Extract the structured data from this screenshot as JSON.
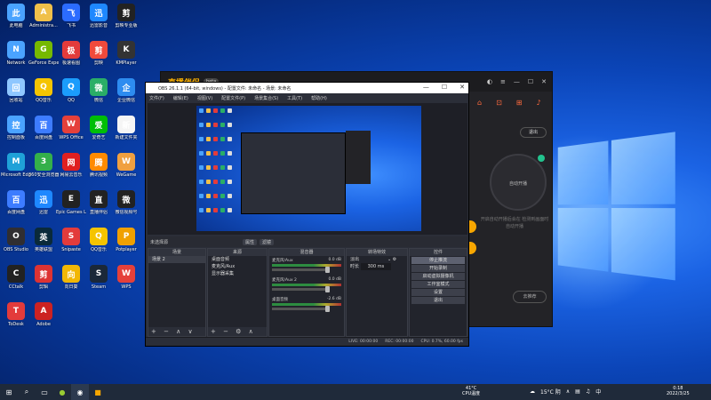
{
  "desktop": {
    "icons": [
      {
        "label": "此电脑",
        "icon": "computer-icon",
        "color": "#4aa3ff"
      },
      {
        "label": "Administra...",
        "icon": "user-folder-icon",
        "color": "#f0c04a"
      },
      {
        "label": "飞书",
        "icon": "feishu-icon",
        "color": "#2b6cff"
      },
      {
        "label": "迅雷影音",
        "icon": "xunlei-icon",
        "color": "#1e88ff"
      },
      {
        "label": "剪映专业版",
        "icon": "jianying-icon",
        "color": "#222222"
      },
      {
        "label": "Network",
        "icon": "network-icon",
        "color": "#4aa3ff"
      },
      {
        "label": "GeForce Experience",
        "icon": "nvidia-icon",
        "color": "#76b900"
      },
      {
        "label": "极速看图",
        "icon": "image-viewer-icon",
        "color": "#e33b3b"
      },
      {
        "label": "剪映",
        "icon": "jianying-app-icon",
        "color": "#f04a3c"
      },
      {
        "label": "KMPlayer",
        "icon": "kmplayer-icon",
        "color": "#333333"
      },
      {
        "label": "回收站",
        "icon": "recycle-bin-icon",
        "color": "#8fc7ff"
      },
      {
        "label": "QQ音乐",
        "icon": "qqmusic-icon",
        "color": "#f5c400"
      },
      {
        "label": "QQ",
        "icon": "qq-icon",
        "color": "#1b9cfc"
      },
      {
        "label": "微信",
        "icon": "wechat-icon",
        "color": "#2aae67"
      },
      {
        "label": "企业微信",
        "icon": "wework-icon",
        "color": "#2d8cf0"
      },
      {
        "label": "控制面板",
        "icon": "control-panel-icon",
        "color": "#4aa3ff"
      },
      {
        "label": "百度网盘",
        "icon": "baidu-pan-icon",
        "color": "#3d7cff"
      },
      {
        "label": "WPS Office",
        "icon": "wps-icon",
        "color": "#e5403a"
      },
      {
        "label": "爱奇艺",
        "icon": "iqiyi-icon",
        "color": "#00be06"
      },
      {
        "label": "新建文件夹",
        "icon": "new-file-icon",
        "color": "#f5f5f5"
      },
      {
        "label": "Microsoft Edge",
        "icon": "edge-icon",
        "color": "#1fa1d8"
      },
      {
        "label": "360安全浏览器",
        "icon": "browser-360-icon",
        "color": "#34b04a"
      },
      {
        "label": "网易云音乐",
        "icon": "netease-music-icon",
        "color": "#e02020"
      },
      {
        "label": "腾讯视频",
        "icon": "tencent-video-icon",
        "color": "#ff8b00"
      },
      {
        "label": "WeGame",
        "icon": "wegame-icon",
        "color": "#f0a040"
      },
      {
        "label": "百度网盘",
        "icon": "pan-icon",
        "color": "#3d7cff"
      },
      {
        "label": "迅雷",
        "icon": "thunder-icon",
        "color": "#1e88ff"
      },
      {
        "label": "Epic Games Launcher",
        "icon": "epic-icon",
        "color": "#222222"
      },
      {
        "label": "直播伴侣",
        "icon": "zbbl-icon",
        "color": "#222222"
      },
      {
        "label": "微信视频号",
        "icon": "channels-icon",
        "color": "#222222"
      },
      {
        "label": "OBS Studio",
        "icon": "obs-icon",
        "color": "#302e31"
      },
      {
        "label": "英雄联盟",
        "icon": "lol-icon",
        "color": "#0a2a3a"
      },
      {
        "label": "Snipaste",
        "icon": "snipaste-icon",
        "color": "#e33b3b"
      },
      {
        "label": "QQ音乐",
        "icon": "qqmusic2-icon",
        "color": "#f5c400"
      },
      {
        "label": "Potplayer",
        "icon": "potplayer-icon",
        "color": "#f0a000"
      },
      {
        "label": "CCtalk",
        "icon": "cctalk-icon",
        "color": "#222222"
      },
      {
        "label": "剪辑",
        "icon": "editor-icon",
        "color": "#d33"
      },
      {
        "label": "向日葵",
        "icon": "sunlogin-icon",
        "color": "#f2b705"
      },
      {
        "label": "Steam",
        "icon": "steam-icon",
        "color": "#1b2838"
      },
      {
        "label": "WPS",
        "icon": "wps2-icon",
        "color": "#e5403a"
      },
      {
        "label": "ToDesk",
        "icon": "todesk-icon",
        "color": "#e33b3b"
      },
      {
        "label": "Adobe",
        "icon": "adobe-icon",
        "color": "#cc2222"
      }
    ]
  },
  "zbapp": {
    "title": "直播伴侣",
    "version": "beta",
    "exit_label": "退出",
    "auto_label": "自动开播",
    "hint": "开启自动开播后会在\n检测到画面时自动开播",
    "preview_btn": "去推荐"
  },
  "obs": {
    "title": "OBS 26.1.1 (64-bit, windows) - 配置文件: 未命名 - 场景: 未命名",
    "menu": [
      "文件(F)",
      "编辑(E)",
      "视图(V)",
      "配置文件(P)",
      "场景集合(S)",
      "工具(T)",
      "帮助(H)"
    ],
    "source_bar": {
      "label": "未选择源",
      "props": "属性",
      "filters": "滤镜"
    },
    "docks": {
      "scenes": {
        "title": "场景",
        "items": [
          "场景 2"
        ]
      },
      "sources": {
        "title": "来源",
        "items": [
          "桌面音频",
          "麦克风/Aux",
          "显示器采集"
        ]
      },
      "mixer": {
        "title": "混音器",
        "channels": [
          {
            "name": "麦克风/Aux",
            "level": "0.0 dB"
          },
          {
            "name": "麦克风/Aux 2",
            "level": "0.0 dB"
          },
          {
            "name": "桌面音频",
            "level": "-2.6 dB"
          }
        ]
      },
      "transitions": {
        "title": "转场特效",
        "type": "淡出",
        "duration_label": "时长",
        "duration": "300 ms"
      },
      "controls": {
        "title": "控件",
        "buttons": [
          "停止推流",
          "开始录制",
          "启动虚拟摄像机",
          "工作室模式",
          "设置",
          "退出"
        ]
      }
    },
    "status": {
      "dropped": "LIVE: 00:00:00",
      "rec": "REC: 00:00:00",
      "cpu": "CPU: 0.7%, 60.00 fps"
    }
  },
  "taskbar": {
    "weather_temp": "41°C",
    "weather_label": "CPU温度",
    "tray_temp": "15°C 阴",
    "time": "0:18",
    "date": "2022/3/25"
  }
}
